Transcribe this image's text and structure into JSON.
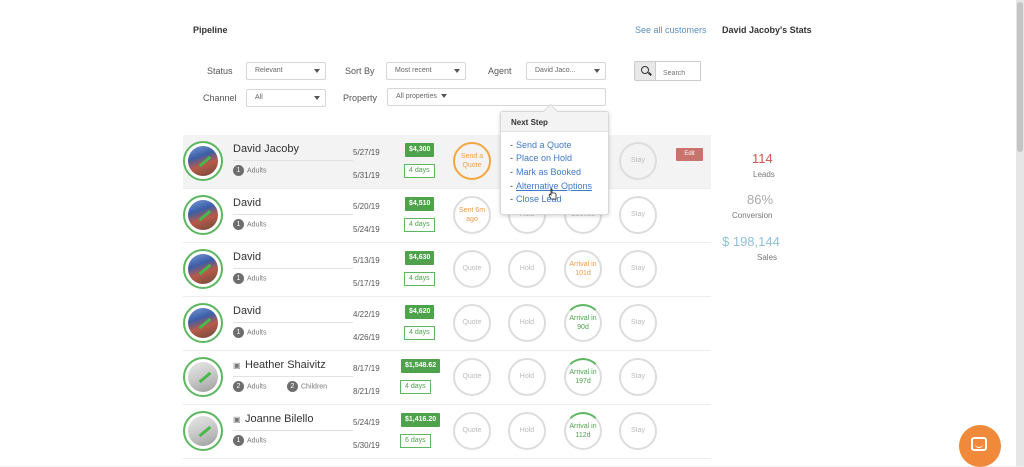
{
  "header": {
    "pipeline": "Pipeline",
    "see_all": "See all customers",
    "stats_title": "David Jacoby's Stats"
  },
  "filters": {
    "status_label": "Status",
    "status_value": "Relevant",
    "sortby_label": "Sort By",
    "sortby_value": "Most recent",
    "agent_label": "Agent",
    "agent_value": "David Jaco...",
    "channel_label": "Channel",
    "channel_value": "All",
    "property_label": "Property",
    "property_value": "All properties",
    "search_placeholder": "Search"
  },
  "rows": [
    {
      "name": "David Jacoby",
      "adults": "1",
      "adults_label": "Adults",
      "date_in": "5/27/19",
      "date_out": "5/31/19",
      "price": "$4,300",
      "days": "4 days",
      "step1": "Send a Quote",
      "step2": "",
      "step3": "",
      "step4": "Stay"
    },
    {
      "name": "David",
      "adults": "1",
      "adults_label": "Adults",
      "date_in": "5/20/19",
      "date_out": "5/24/19",
      "price": "$4,510",
      "days": "4 days",
      "step1": "Sent 6m ago",
      "step2": "Hold",
      "step3": "Booked",
      "step4": "Stay"
    },
    {
      "name": "David",
      "adults": "1",
      "adults_label": "Adults",
      "date_in": "5/13/19",
      "date_out": "5/17/19",
      "price": "$4,630",
      "days": "4 days",
      "step1": "Quote",
      "step2": "Hold",
      "step3": "Arrival in 101d",
      "step4": "Stay"
    },
    {
      "name": "David",
      "adults": "1",
      "adults_label": "Adults",
      "date_in": "4/22/19",
      "date_out": "4/26/19",
      "price": "$4,620",
      "days": "4 days",
      "step1": "Quote",
      "step2": "Hold",
      "step3": "Arrival in 90d",
      "step4": "Stay"
    },
    {
      "name": "Heather Shaivitz",
      "adults": "2",
      "adults_label": "Adults",
      "children": "2",
      "children_label": "Children",
      "date_in": "8/17/19",
      "date_out": "8/21/19",
      "price": "$1,548.62",
      "days": "4 days",
      "step1": "Quote",
      "step2": "Hold",
      "step3": "Arrival in 197d",
      "step4": "Stay"
    },
    {
      "name": "Joanne Bilello",
      "adults": "1",
      "adults_label": "Adults",
      "date_in": "5/24/19",
      "date_out": "5/30/19",
      "price": "$1,416.20",
      "days": "6 days",
      "step1": "Quote",
      "step2": "Hold",
      "step3": "Arrival in 112d",
      "step4": "Stay"
    }
  ],
  "edit_label": "Edit",
  "stats": {
    "leads_value": "114",
    "leads_label": "Leads",
    "conversion_value": "86%",
    "conversion_label": "Conversion",
    "sales_value": "$ 198,144",
    "sales_label": "Sales"
  },
  "popover": {
    "title": "Next Step",
    "items": [
      "Send a Quote",
      "Place on Hold",
      "Mark as Booked",
      "Alternative Options",
      "Close Lead"
    ]
  },
  "colors": {
    "accent_green": "#4fa24c",
    "link_blue": "#5b8fc2",
    "edit_red": "#c9736f",
    "chat_orange": "#f08a3a",
    "leads_red": "#d9534f"
  }
}
